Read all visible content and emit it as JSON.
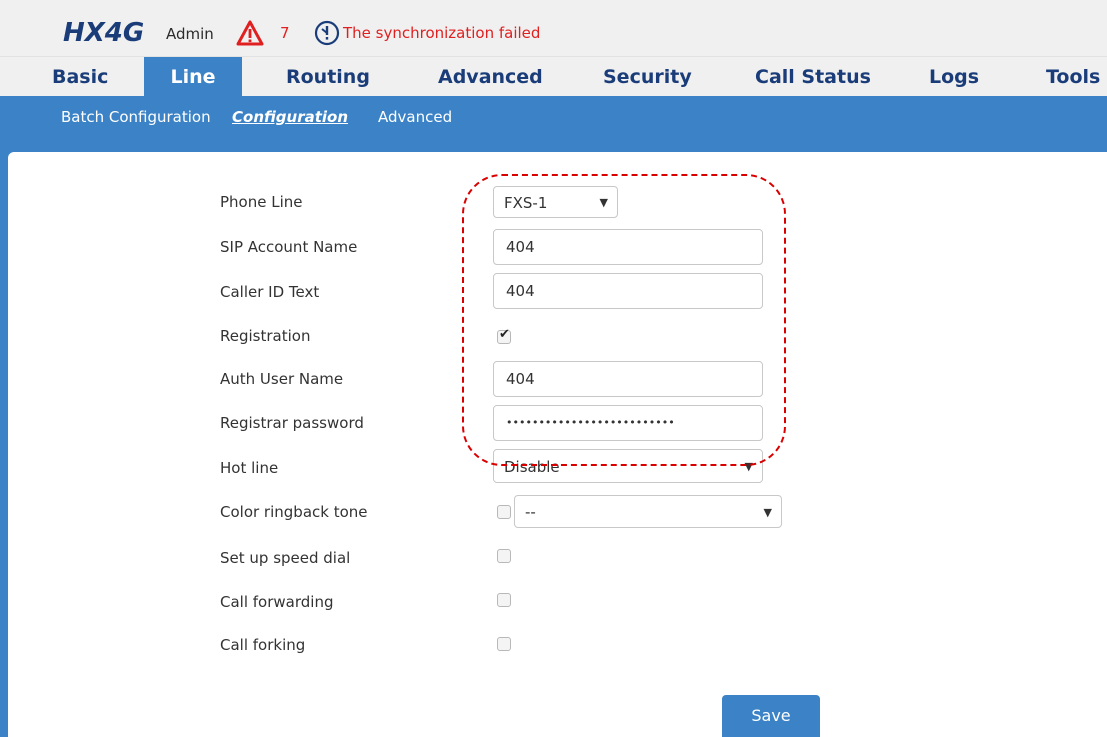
{
  "header": {
    "logo": "HX4G",
    "user": "Admin",
    "alert_count": "7",
    "sync_message": "The synchronization failed"
  },
  "main_nav": [
    {
      "label": "Basic",
      "active": false
    },
    {
      "label": "Line",
      "active": true
    },
    {
      "label": "Routing",
      "active": false
    },
    {
      "label": "Advanced",
      "active": false
    },
    {
      "label": "Security",
      "active": false
    },
    {
      "label": "Call Status",
      "active": false
    },
    {
      "label": "Logs",
      "active": false
    },
    {
      "label": "Tools",
      "active": false
    }
  ],
  "sub_nav": [
    {
      "label": "Batch Configuration",
      "active": false
    },
    {
      "label": "Configuration",
      "active": true
    },
    {
      "label": "Advanced",
      "active": false
    }
  ],
  "form": {
    "phone_line": {
      "label": "Phone Line",
      "value": "FXS-1"
    },
    "sip_account_name": {
      "label": "SIP Account Name",
      "value": "404"
    },
    "caller_id_text": {
      "label": "Caller ID Text",
      "value": "404"
    },
    "registration": {
      "label": "Registration",
      "checked": true
    },
    "auth_user_name": {
      "label": "Auth User Name",
      "value": "404"
    },
    "registrar_password": {
      "label": "Registrar password",
      "value": "••••••••••••••••••••••••••"
    },
    "hot_line": {
      "label": "Hot line",
      "value": "Disable"
    },
    "color_ringback_tone": {
      "label": "Color ringback tone",
      "checked": false,
      "value": "--"
    },
    "speed_dial": {
      "label": "Set up speed dial",
      "checked": false
    },
    "call_forwarding": {
      "label": "Call forwarding",
      "checked": false
    },
    "call_forking": {
      "label": "Call forking",
      "checked": false
    }
  },
  "save_label": "Save",
  "colors": {
    "accent": "#3b83c6",
    "nav_text": "#1a3d7a",
    "alert": "#e02020",
    "highlight": "#d90000"
  },
  "icons": {
    "alert": "warning-triangle-icon",
    "sync": "clock-alert-icon"
  }
}
